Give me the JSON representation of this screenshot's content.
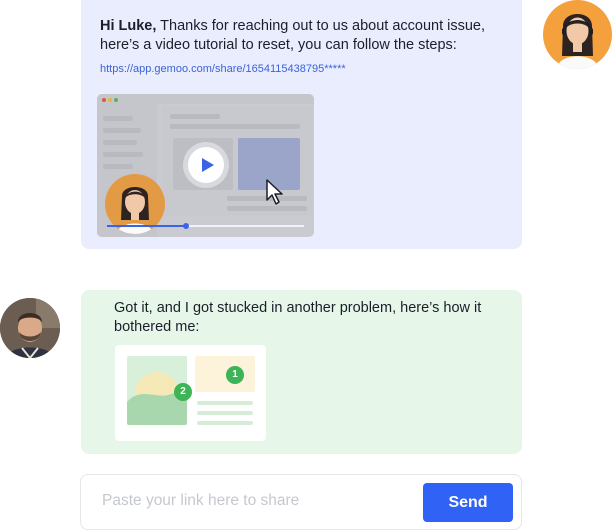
{
  "agent_message": {
    "greeting": "Hi Luke,",
    "body": " Thanks for reaching out to us about account issue, here’s a video tutorial to reset, you can follow the steps:",
    "link": "https://app.gemoo.com/share/1654115438795*****",
    "video": {
      "progress": 0.4
    }
  },
  "user_message": {
    "body": "Got it, and I got stucked in another problem, here’s how it bothered me:",
    "attachment": {
      "badge_1": "1",
      "badge_2": "2"
    }
  },
  "composer": {
    "placeholder": "Paste your link here to share",
    "value": "",
    "send_label": "Send"
  },
  "colors": {
    "accent": "#2f62f5",
    "agent_bubble": "#eaedfd",
    "user_bubble": "#e6f6e9",
    "badge": "#3db455"
  },
  "icons": [
    "play-icon",
    "cursor-icon"
  ]
}
